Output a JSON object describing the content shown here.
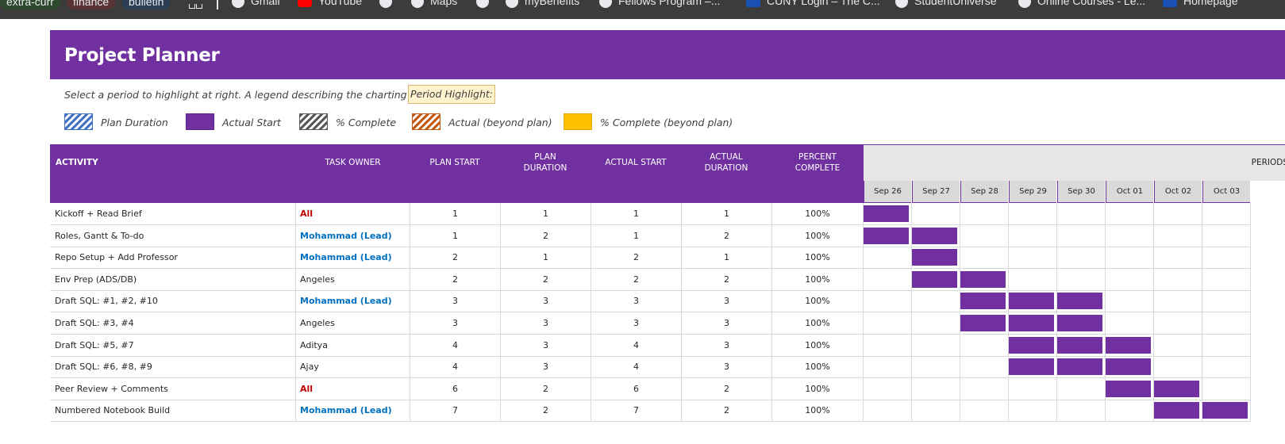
{
  "bookmarks": {
    "chips": [
      {
        "label": "extra-curr",
        "bg": "#2e4a2e"
      },
      {
        "label": "finance",
        "bg": "#5a3434"
      },
      {
        "label": "bulletin",
        "bg": "#2c3e55"
      }
    ],
    "links": [
      {
        "label": "Gmail",
        "icon": "globe-icon"
      },
      {
        "label": "YouTube",
        "icon": "youtube-icon"
      },
      {
        "label": "",
        "icon": "globe-icon"
      },
      {
        "label": "Maps",
        "icon": "globe-icon"
      },
      {
        "label": "",
        "icon": "globe-icon"
      },
      {
        "label": "myBenefits",
        "icon": "globe-icon"
      },
      {
        "label": "Fellows Program –...",
        "icon": "globe-icon"
      },
      {
        "label": "CUNY Login – The C...",
        "icon": "nv-icon"
      },
      {
        "label": "StudentUniverse",
        "icon": "globe-icon"
      },
      {
        "label": "Online Courses - Le...",
        "icon": "globe-icon"
      },
      {
        "label": "Homepage",
        "icon": "nv-icon"
      }
    ]
  },
  "planner": {
    "title": "Project Planner",
    "hint": "Select a period to highlight at right. A legend describing the charting follows:",
    "period_highlight_label": "Period Highlight:",
    "legend": [
      {
        "label": "Plan Duration",
        "swatch": "plan"
      },
      {
        "label": "Actual Start",
        "swatch": "actual"
      },
      {
        "label": "% Complete",
        "swatch": "pct"
      },
      {
        "label": "Actual (beyond plan)",
        "swatch": "beyond"
      },
      {
        "label": "% Complete (beyond plan)",
        "swatch": "pctb"
      }
    ],
    "columns": {
      "activity": "ACTIVITY",
      "owner": "TASK OWNER",
      "plan_start": "PLAN START",
      "plan_duration": "PLAN\nDURATION",
      "actual_start": "ACTUAL START",
      "actual_duration": "ACTUAL\nDURATION",
      "percent_complete": "PERCENT\nCOMPLETE",
      "periods": "PERIODS"
    },
    "dates": [
      "Sep 26",
      "Sep 27",
      "Sep 28",
      "Sep 29",
      "Sep 30",
      "Oct 01",
      "Oct 02",
      "Oct 03"
    ],
    "colors": {
      "accent": "#7030a0",
      "owner_all": "#c00000",
      "owner_lead": "#0070c0"
    },
    "rows": [
      {
        "activity": "Kickoff + Read Brief",
        "owner": "All",
        "owner_style": "red",
        "plan_start": "1",
        "plan_duration": "1",
        "actual_start": "1",
        "actual_duration": "1",
        "percent": "100%",
        "bar_start_period": 1,
        "bar_periods": 1
      },
      {
        "activity": "Roles, Gantt & To-do",
        "owner": "Mohammad (Lead)",
        "owner_style": "blue",
        "plan_start": "1",
        "plan_duration": "2",
        "actual_start": "1",
        "actual_duration": "2",
        "percent": "100%",
        "bar_start_period": 1,
        "bar_periods": 2
      },
      {
        "activity": "Repo Setup + Add Professor",
        "owner": "Mohammad (Lead)",
        "owner_style": "blue",
        "plan_start": "2",
        "plan_duration": "1",
        "actual_start": "2",
        "actual_duration": "1",
        "percent": "100%",
        "bar_start_period": 2,
        "bar_periods": 1
      },
      {
        "activity": "Env Prep (ADS/DB)",
        "owner": "Angeles",
        "owner_style": "plain",
        "plan_start": "2",
        "plan_duration": "2",
        "actual_start": "2",
        "actual_duration": "2",
        "percent": "100%",
        "bar_start_period": 2,
        "bar_periods": 2
      },
      {
        "activity": "Draft SQL: #1, #2, #10",
        "owner": "Mohammad (Lead)",
        "owner_style": "blue",
        "plan_start": "3",
        "plan_duration": "3",
        "actual_start": "3",
        "actual_duration": "3",
        "percent": "100%",
        "bar_start_period": 3,
        "bar_periods": 3
      },
      {
        "activity": "Draft SQL: #3, #4",
        "owner": "Angeles",
        "owner_style": "plain",
        "plan_start": "3",
        "plan_duration": "3",
        "actual_start": "3",
        "actual_duration": "3",
        "percent": "100%",
        "bar_start_period": 3,
        "bar_periods": 3
      },
      {
        "activity": "Draft SQL: #5, #7",
        "owner": "Aditya",
        "owner_style": "plain",
        "plan_start": "4",
        "plan_duration": "3",
        "actual_start": "4",
        "actual_duration": "3",
        "percent": "100%",
        "bar_start_period": 4,
        "bar_periods": 3
      },
      {
        "activity": "Draft SQL: #6, #8, #9",
        "owner": "Ajay",
        "owner_style": "plain",
        "plan_start": "4",
        "plan_duration": "3",
        "actual_start": "4",
        "actual_duration": "3",
        "percent": "100%",
        "bar_start_period": 4,
        "bar_periods": 3
      },
      {
        "activity": "Peer Review + Comments",
        "owner": "All",
        "owner_style": "red",
        "plan_start": "6",
        "plan_duration": "2",
        "actual_start": "6",
        "actual_duration": "2",
        "percent": "100%",
        "bar_start_period": 6,
        "bar_periods": 2
      },
      {
        "activity": "Numbered Notebook Build",
        "owner": "Mohammad (Lead)",
        "owner_style": "blue",
        "plan_start": "7",
        "plan_duration": "2",
        "actual_start": "7",
        "actual_duration": "2",
        "percent": "100%",
        "bar_start_period": 7,
        "bar_periods": 2
      }
    ]
  }
}
